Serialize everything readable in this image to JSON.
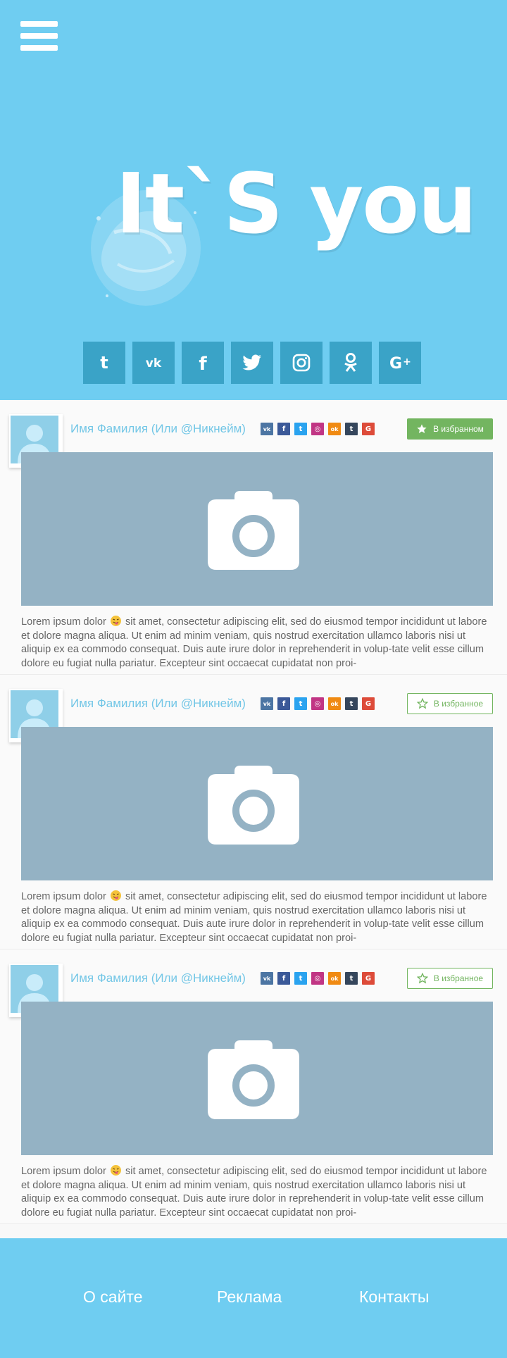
{
  "header": {
    "logo_text": "It`S you"
  },
  "social": [
    "tumblr-icon",
    "vk-icon",
    "facebook-icon",
    "twitter-icon",
    "instagram-icon",
    "odnoklassniki-icon",
    "google-plus-icon"
  ],
  "posts": [
    {
      "name": "Имя Фамилия (Или @Никнейм)",
      "fav_label": "В избранном",
      "fav_active": true,
      "text_before": "Lorem ipsum dolor",
      "text_after": "sit amet, consectetur adipiscing elit, sed do eiusmod tempor incididunt ut labore et dolore magna aliqua. Ut enim ad minim veniam, quis nostrud exercitation ullamco laboris nisi ut aliquip ex ea commodo consequat. Duis aute irure dolor in reprehenderit in volup-tate velit esse cillum dolore eu fugiat nulla pariatur. Excepteur sint occaecat cupidatat non proi-"
    },
    {
      "name": "Имя Фамилия (Или @Никнейм)",
      "fav_label": "В избранное",
      "fav_active": false,
      "text_before": "Lorem ipsum dolor",
      "text_after": "sit amet, consectetur adipiscing elit, sed do eiusmod tempor incididunt ut labore et dolore magna aliqua. Ut enim ad minim veniam, quis nostrud exercitation ullamco laboris nisi ut aliquip ex ea commodo consequat. Duis aute irure dolor in reprehenderit in volup-tate velit esse cillum dolore eu fugiat nulla pariatur. Excepteur sint occaecat cupidatat non proi-"
    },
    {
      "name": "Имя Фамилия (Или @Никнейм)",
      "fav_label": "В избранное",
      "fav_active": false,
      "text_before": "Lorem ipsum dolor",
      "text_after": "sit amet, consectetur adipiscing elit, sed do eiusmod tempor incididunt ut labore et dolore magna aliqua. Ut enim ad minim veniam, quis nostrud exercitation ullamco laboris nisi ut aliquip ex ea commodo consequat. Duis aute irure dolor in reprehenderit in volup-tate velit esse cillum dolore eu fugiat nulla pariatur. Excepteur sint occaecat cupidatat non proi-"
    }
  ],
  "mini_icons": [
    {
      "name": "vk-icon",
      "glyph": "vk",
      "color": "#4c75a3"
    },
    {
      "name": "facebook-icon",
      "glyph": "f",
      "color": "#3b5998"
    },
    {
      "name": "twitter-icon",
      "glyph": "t",
      "color": "#2aa3ef"
    },
    {
      "name": "instagram-icon",
      "glyph": "◎",
      "color": "#c13584"
    },
    {
      "name": "odnoklassniki-icon",
      "glyph": "ok",
      "color": "#f08a12"
    },
    {
      "name": "tumblr-icon",
      "glyph": "t",
      "color": "#35465c"
    },
    {
      "name": "google-plus-icon",
      "glyph": "G",
      "color": "#dd4b39"
    }
  ],
  "colors": {
    "accent": "#6fcdf1",
    "social_button": "#3aa3c7",
    "favorite_green": "#73b560",
    "photo_placeholder": "#94b2c4"
  },
  "footer": {
    "about": "О сайте",
    "ads": "Реклама",
    "contacts": "Контакты"
  }
}
